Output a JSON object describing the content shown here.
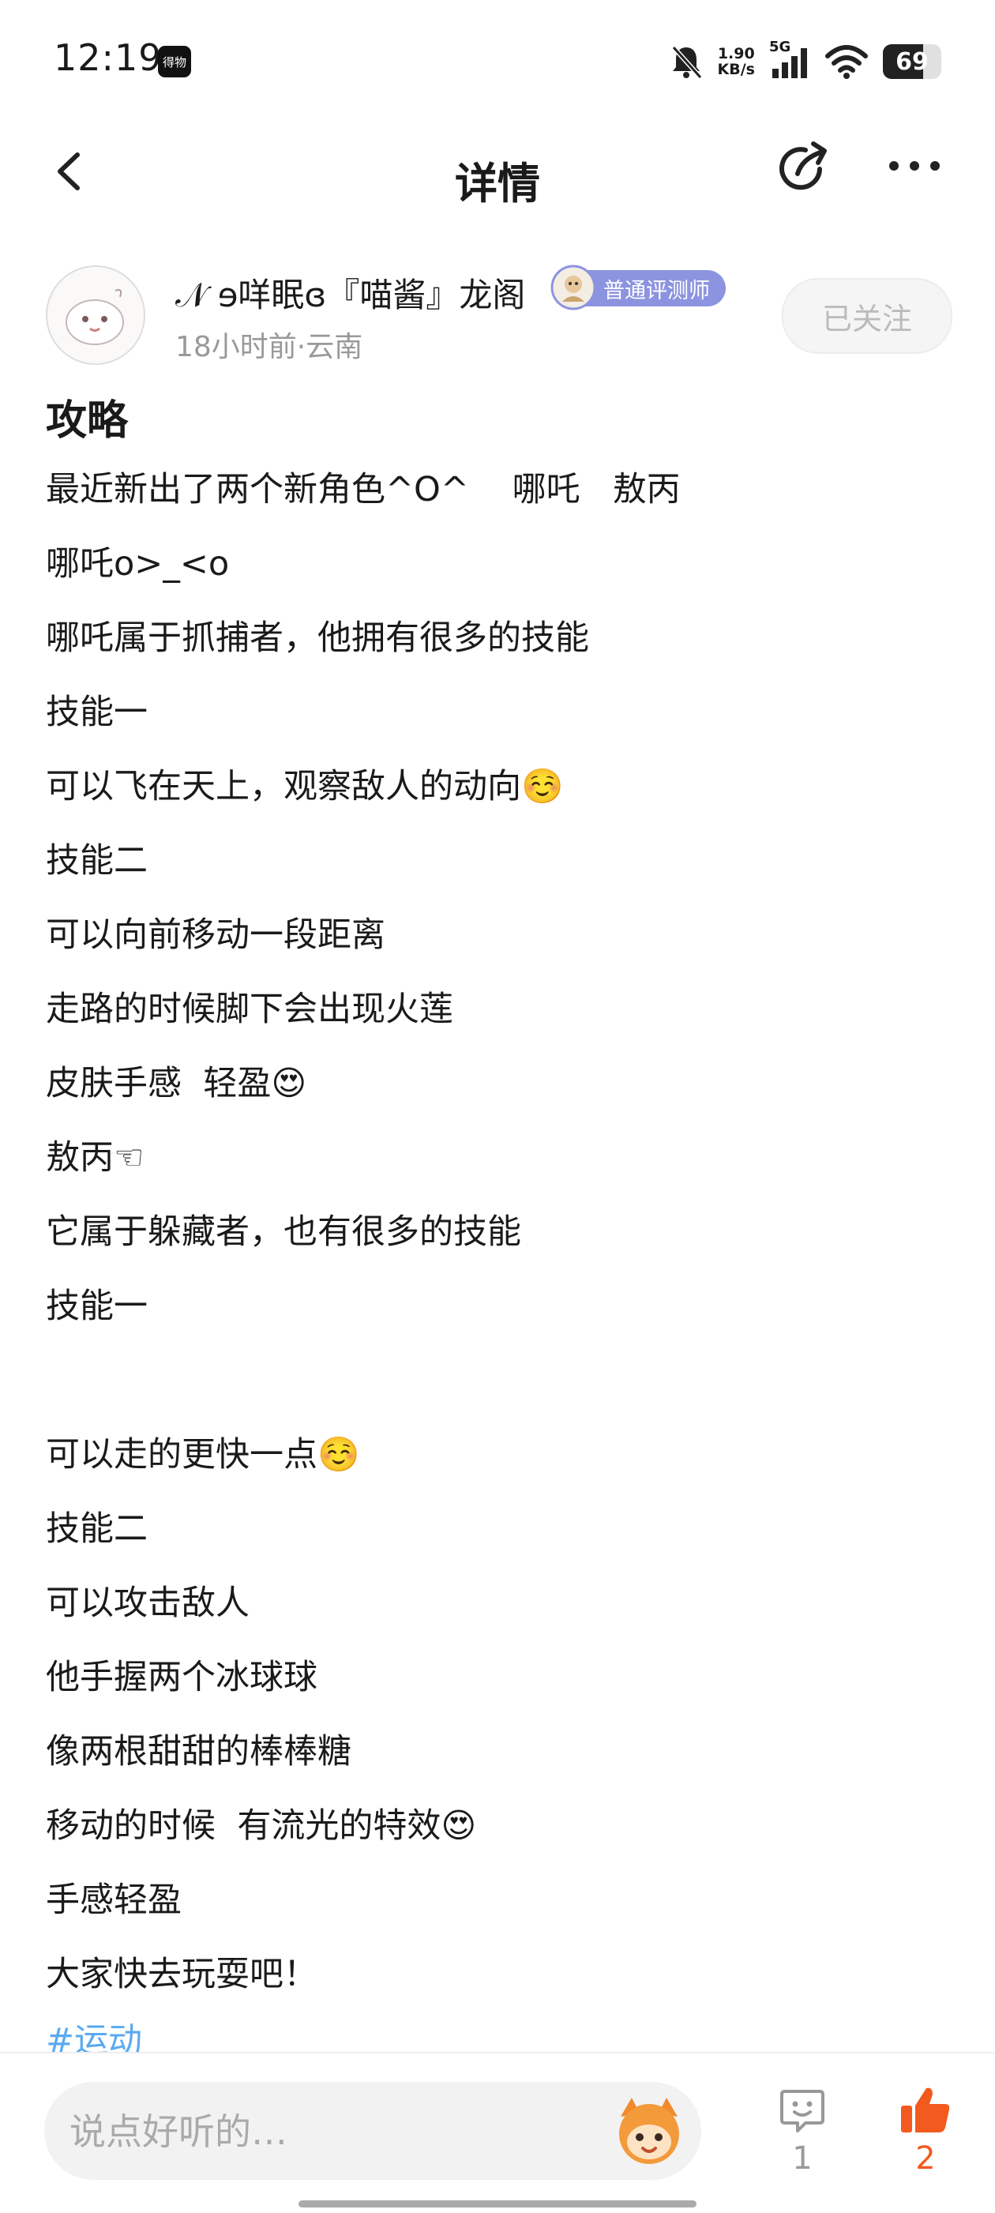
{
  "status_bar": {
    "time": "12:19",
    "app_badge": "得物",
    "speed_value": "1.90",
    "speed_unit": "KB/s",
    "network": "5G",
    "battery": 69
  },
  "nav": {
    "title": "详情",
    "back_icon": "chevron-left-icon",
    "share_icon": "share-icon",
    "more_icon": "more-dots-icon"
  },
  "author": {
    "name": "𝒩 ɘ咩眠ɞ『喵酱』龙阁",
    "badge": "普通评测师",
    "meta": "18小时前·云南",
    "follow_label": "已关注"
  },
  "post": {
    "title": "攻略",
    "lines": [
      "最近新出了两个新角色^O^    哪吒   敖丙",
      "哪吒o>_<o",
      "哪吒属于抓捕者，他拥有很多的技能",
      "技能一",
      "可以飞在天上，观察敌人的动向☺️",
      "技能二",
      "可以向前移动一段距离",
      "走路的时候脚下会出现火莲",
      "皮肤手感  轻盈😍",
      "敖丙☜",
      "它属于躲藏者，也有很多的技能",
      "技能一",
      "",
      "可以走的更快一点☺️",
      "技能二",
      "可以攻击敌人",
      "他手握两个冰球球",
      "像两根甜甜的棒棒糖",
      "移动的时候  有流光的特效😍",
      "手感轻盈",
      "大家快去玩耍吧！"
    ],
    "hashtag": "#运动"
  },
  "bottom_bar": {
    "comment_placeholder": "说点好听的…",
    "comment_count": "1",
    "like_count": "2",
    "colors": {
      "like_active": "#f25a1e",
      "hashtag": "#5aaaf0"
    }
  }
}
